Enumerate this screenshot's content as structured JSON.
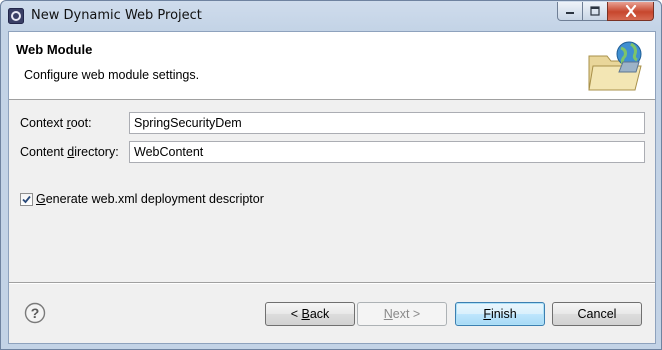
{
  "window": {
    "title": "New Dynamic Web Project",
    "controls": {
      "minimize_icon": "minimize-icon",
      "maximize_icon": "maximize-icon",
      "close_icon": "close-icon"
    }
  },
  "header": {
    "title": "Web Module",
    "description": "Configure web module settings.",
    "icon": "web-project-folder-globe-icon"
  },
  "form": {
    "context_root": {
      "label_pre": "Context ",
      "label_mnemonic": "r",
      "label_post": "oot:",
      "value": "SpringSecurityDem"
    },
    "content_directory": {
      "label_pre": "Content ",
      "label_mnemonic": "d",
      "label_post": "irectory:",
      "value": "WebContent"
    },
    "generate_web_xml": {
      "checked": true,
      "label_mnemonic": "G",
      "label_post": "enerate web.xml deployment descriptor"
    }
  },
  "footer": {
    "help_icon": "help-icon",
    "back": {
      "pre": "< ",
      "mnemonic": "B",
      "post": "ack"
    },
    "next": {
      "pre": "",
      "mnemonic": "N",
      "post": "ext >"
    },
    "finish": {
      "mnemonic": "F",
      "post": "inish"
    },
    "cancel": "Cancel"
  },
  "colors": {
    "window_frame": "#c3d3e6",
    "client_bg": "#f0f0f0",
    "close_button": "#c7462d",
    "default_button_border": "#3c7fb1"
  }
}
